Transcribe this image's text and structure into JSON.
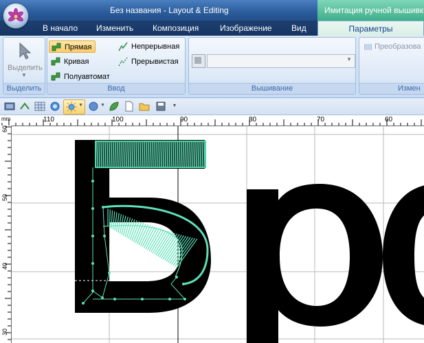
{
  "window": {
    "title": "Без названия - Layout & Editing",
    "context_header": "Имитация ручной вышивки"
  },
  "tabs": [
    "В начало",
    "Изменить",
    "Композиция",
    "Изображение",
    "Вид"
  ],
  "active_tab": "Параметры",
  "ribbon": {
    "select_group": {
      "button_label": "Выделить",
      "group_label": "Выделить"
    },
    "input_group": {
      "group_label": "Ввод",
      "buttons": {
        "straight": "Прямая",
        "curve": "Кривая",
        "semi": "Полуавтомат",
        "continuous": "Непрерывная",
        "dashed": "Прерывистая"
      }
    },
    "embroidery_group": {
      "group_label": "Вышивание"
    },
    "transform_group": {
      "button_label": "Преобразова",
      "group_label": "Измен"
    }
  },
  "ruler": {
    "unit": "mm",
    "h_labels": [
      "110",
      "100",
      "90",
      "80",
      "70",
      "60"
    ],
    "v_labels": [
      "60",
      "50",
      "40",
      "30"
    ]
  },
  "canvas": {
    "letters": [
      "Б",
      "р",
      "о"
    ]
  },
  "colors": {
    "accent": "#3fae8a",
    "stitch": "#5ee0b8",
    "ribbon_bg": "#dbe8f6",
    "titlebar": "#2b5c9c"
  }
}
